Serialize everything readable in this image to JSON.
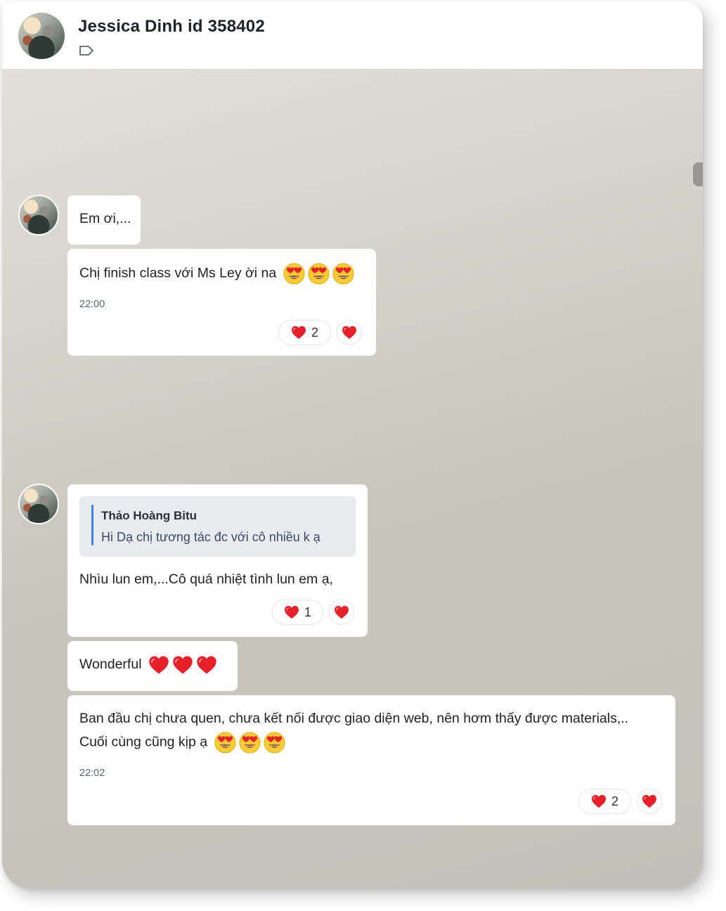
{
  "header": {
    "title": "Jessica Dinh id 358402",
    "tag_icon": "tag-icon"
  },
  "messages": {
    "m1": {
      "text": "Em ơi,..."
    },
    "m2": {
      "text": "Chị finish class với Ms Ley ời na",
      "emoji": "heart-eyes x3",
      "time": "22:00",
      "reaction_count": "2"
    },
    "m3": {
      "quote_name": "Thảo Hoàng Bitu",
      "quote_text": "Hi Dạ chị tương tác đc với cô nhiều k ạ",
      "text": "Nhìu lun em,...Cô quá nhiệt tình lun em ạ,",
      "reaction_count": "1"
    },
    "m4": {
      "text": "Wonderful",
      "emoji": "red-heart x3"
    },
    "m5": {
      "line1": "Ban đầu chị chưa quen, chưa kết nối được giao diện web, nên hơm thấy được materials,..",
      "line2": "Cuối cùng cũng kịp ạ",
      "emoji": "heart-eyes x3",
      "time": "22:02",
      "reaction_count": "2"
    }
  },
  "colors": {
    "heart": "#e8202a",
    "accent": "#3b82f6",
    "bubble": "#ffffff"
  }
}
